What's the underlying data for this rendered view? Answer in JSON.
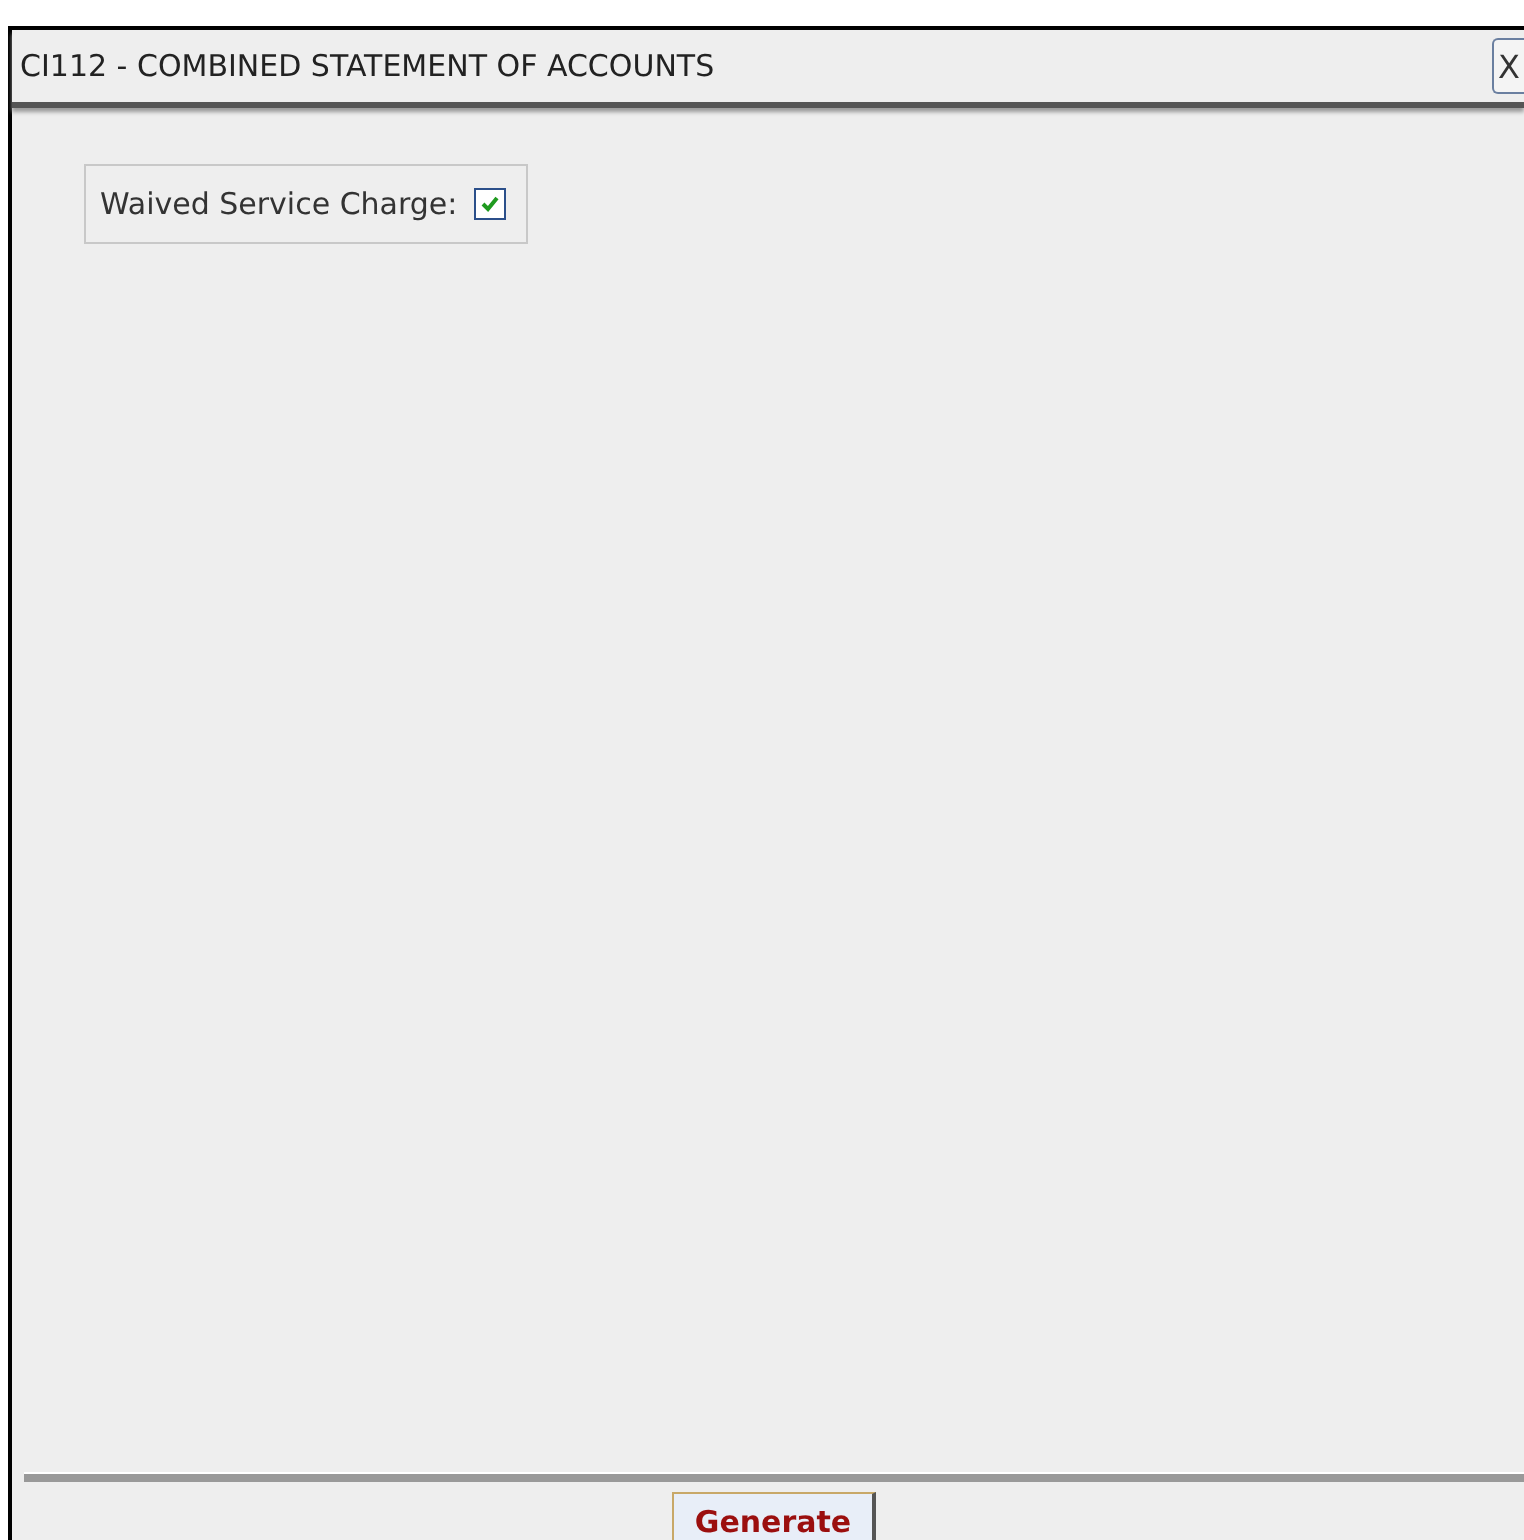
{
  "window": {
    "title": "CI112 - COMBINED STATEMENT OF ACCOUNTS",
    "close_label": "X"
  },
  "options": [
    {
      "label": "Waived Service Charge:",
      "checked": true
    }
  ],
  "buttons": [
    {
      "label": "Generate"
    }
  ]
}
